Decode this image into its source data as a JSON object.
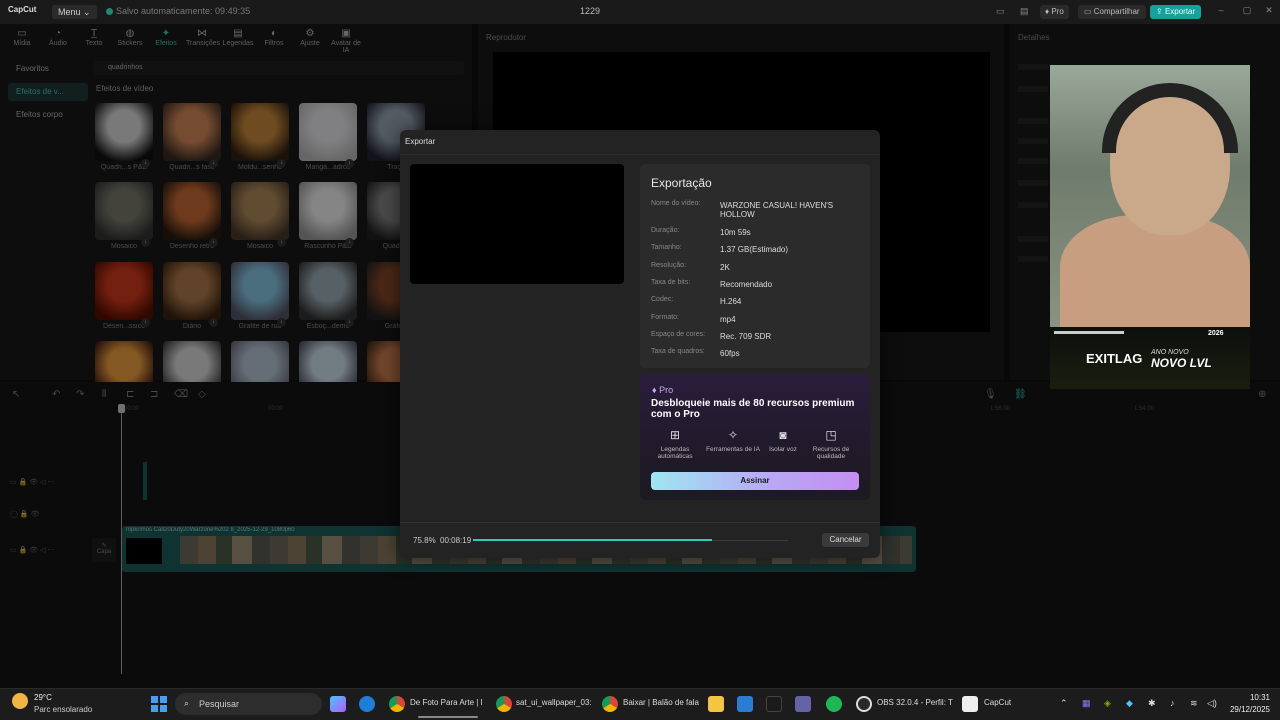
{
  "app": {
    "logo": "CapCut",
    "menu": "Menu",
    "autosave": "Salvo automaticamente: 09:49:35",
    "project_title": "1229",
    "pro": "Pro",
    "share": "Compartilhar",
    "export": "Exportar"
  },
  "tabs": [
    {
      "label": "Mídia",
      "icon": "media-icon"
    },
    {
      "label": "Áudio",
      "icon": "audio-icon"
    },
    {
      "label": "Texto",
      "icon": "text-icon"
    },
    {
      "label": "Stickers",
      "icon": "sticker-icon"
    },
    {
      "label": "Efeitos",
      "icon": "effects-icon"
    },
    {
      "label": "Transições",
      "icon": "transitions-icon"
    },
    {
      "label": "Legendas",
      "icon": "captions-icon"
    },
    {
      "label": "Filtros",
      "icon": "filters-icon"
    },
    {
      "label": "Ajuste",
      "icon": "adjust-icon"
    },
    {
      "label": "Avatar de IA",
      "icon": "avatar-icon"
    }
  ],
  "sidebar": [
    "Favoritos",
    "Efeitos de v...",
    "Efeitos corpo"
  ],
  "search": {
    "value": "quadrinhos"
  },
  "effects_heading": "Efeitos de vídeo",
  "effects": [
    "Quadri...s P&B",
    "Quadri...s fase",
    "Moldu...senho",
    "Mangá...adros",
    "Traço",
    "Mosaico",
    "Desenho retrô",
    "Mosaico",
    "Rascunho P&B",
    "Quadri...",
    "Desen...ssico",
    "Diário",
    "Grafite de rua",
    "Esboç...demo",
    "Gráfico"
  ],
  "player_label": "Reprodutor",
  "details_label": "Detalhes",
  "timeline": {
    "ticks": [
      "00:00",
      "00:00",
      "1:56:00",
      "1:54:00"
    ],
    "clip_label": "mpkrimos  Call20Duty20Warzone%202 II_2025-12-29_1080p60",
    "capa": "Capa"
  },
  "webcam_banner": {
    "logo": "EXITLAG",
    "ano": "ANO NOVO",
    "novo": "NOVO LVL",
    "year": "2026"
  },
  "modal": {
    "title": "Exportar",
    "card_title": "Exportação",
    "info": [
      {
        "k": "Nome do vídeo:",
        "v": "WARZONE CASUAL! HAVEN'S HOLLOW"
      },
      {
        "k": "Duração:",
        "v": "10m 59s"
      },
      {
        "k": "Tamanho:",
        "v": "1.37 GB(Estimado)"
      },
      {
        "k": "Resolução:",
        "v": "2K"
      },
      {
        "k": "Taxa de bits:",
        "v": "Recomendado"
      },
      {
        "k": "Codec:",
        "v": "H.264"
      },
      {
        "k": "Formato:",
        "v": "mp4"
      },
      {
        "k": "Espaço de cores:",
        "v": "Rec. 709 SDR"
      },
      {
        "k": "Taxa de quadros:",
        "v": "60fps"
      }
    ],
    "pro_badge": "Pro",
    "pro_heading": "Desbloqueie mais de 80 recursos premium com o Pro",
    "features": [
      {
        "label": "Legendas automáticas",
        "icon": "captions-icon"
      },
      {
        "label": "Ferramentas de IA",
        "icon": "magic-wand-icon"
      },
      {
        "label": "Isolar voz",
        "icon": "voice-icon"
      },
      {
        "label": "Recursos de qualidade",
        "icon": "quality-icon"
      }
    ],
    "subscribe": "Assinar",
    "progress_pct": "75.8%",
    "progress_fraction": 0.758,
    "elapsed": "00:08:19",
    "cancel": "Cancelar"
  },
  "taskbar": {
    "temp": "29°C",
    "weather": "Parc ensolarado",
    "search": "Pesquisar",
    "apps": [
      "De Foto Para Arte | I",
      "sat_ui_wallpaper_03:",
      "Baixar | Balão de fala",
      "OBS 32.0.4 - Perfil: T",
      "CapCut"
    ],
    "time": "10:31",
    "date": "29/12/2025"
  }
}
